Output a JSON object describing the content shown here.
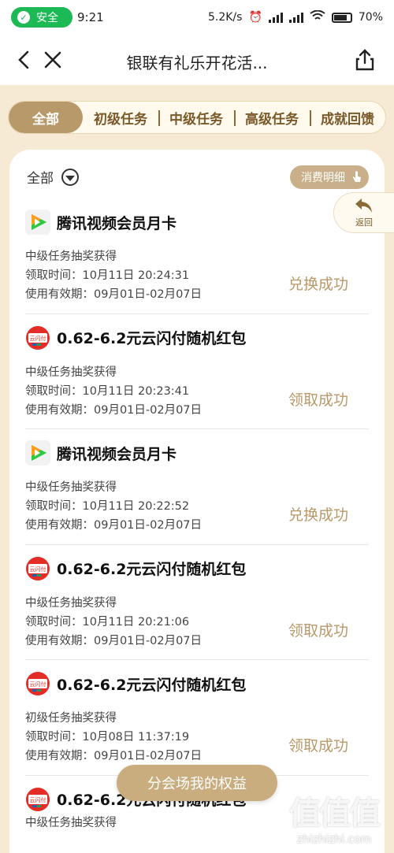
{
  "status_bar": {
    "safe_label": "安全",
    "time": "9:21",
    "speed": "5.2K/s",
    "battery": "70%"
  },
  "header": {
    "title": "银联有礼乐开花活..."
  },
  "tabs": [
    {
      "label": "全部",
      "active": true
    },
    {
      "label": "初级任务"
    },
    {
      "label": "中级任务"
    },
    {
      "label": "高级任务"
    },
    {
      "label": "成就回馈"
    }
  ],
  "filter": {
    "label": "全部"
  },
  "detail_button": {
    "label": "消费明细"
  },
  "float_back": {
    "label": "返回"
  },
  "items": [
    {
      "logo": "tencent-video",
      "title": "腾讯视频会员月卡",
      "source": "中级任务抽奖获得",
      "received": "领取时间：10月11日 20:24:31",
      "validity": "使用有效期：09月01日-02月07日",
      "status": "兑换成功"
    },
    {
      "logo": "cloud-quickpass",
      "title": "0.62-6.2元云闪付随机红包",
      "source": "中级任务抽奖获得",
      "received": "领取时间：10月11日 20:23:41",
      "validity": "使用有效期：09月01日-02月07日",
      "status": "领取成功"
    },
    {
      "logo": "tencent-video",
      "title": "腾讯视频会员月卡",
      "source": "中级任务抽奖获得",
      "received": "领取时间：10月11日 20:22:52",
      "validity": "使用有效期：09月01日-02月07日",
      "status": "兑换成功"
    },
    {
      "logo": "cloud-quickpass",
      "title": "0.62-6.2元云闪付随机红包",
      "source": "中级任务抽奖获得",
      "received": "领取时间：10月11日 20:21:06",
      "validity": "使用有效期：09月01日-02月07日",
      "status": "领取成功"
    },
    {
      "logo": "cloud-quickpass",
      "title": "0.62-6.2元云闪付随机红包",
      "source": "初级任务抽奖获得",
      "received": "领取时间：10月08日 11:37:19",
      "validity": "使用有效期：09月01日-02月07日",
      "status": "领取成功"
    },
    {
      "logo": "cloud-quickpass",
      "title": "0.62-6.2元云闪付随机红包",
      "source": "中级任务抽奖获得",
      "received": "",
      "validity": "",
      "status": ""
    }
  ],
  "bottom_button": {
    "label": "分会场我的权益"
  },
  "watermark": {
    "mark": "值值值",
    "text": "zhizhizhi.com"
  },
  "colors": {
    "accent": "#b89969",
    "page_bg": "#f6ead4"
  }
}
